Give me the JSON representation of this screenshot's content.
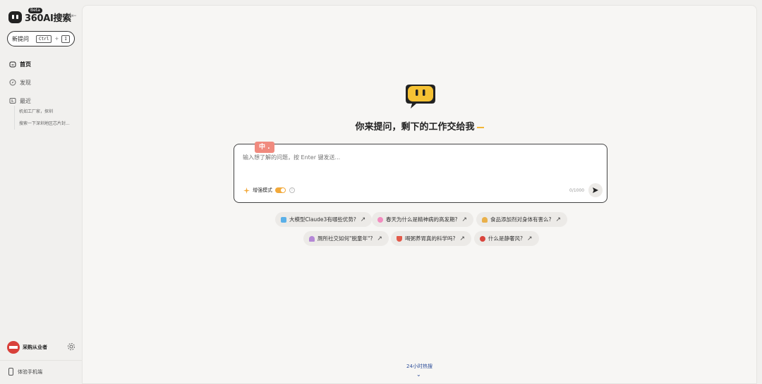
{
  "app": {
    "logo_text": "360AI搜索",
    "logo_badge": "Beta"
  },
  "sidebar": {
    "new_question": {
      "label": "新提问",
      "shortcut_key1": "Ctrl",
      "shortcut_plus": "+",
      "shortcut_key2": "I"
    },
    "nav": [
      {
        "label": "首页",
        "icon": "home-icon"
      },
      {
        "label": "发现",
        "icon": "compass-icon"
      },
      {
        "label": "最近",
        "icon": "history-icon"
      }
    ],
    "recent": [
      "机如工厂家，探圳",
      "搜索一下深圳地区芯片封..."
    ],
    "user": {
      "name": "采购从业者"
    },
    "mobile": {
      "label": "体验手机端"
    }
  },
  "main": {
    "headline": "你来提问，剩下的工作交给我",
    "input": {
      "ime_label": "中 .",
      "placeholder": "输入想了解的问题，按 Enter 键发送...",
      "mode_label": "增强模式",
      "counter": "0/1000"
    },
    "suggestions": [
      {
        "text": "大模型Claude3有哪些优势?",
        "color": "#5ab0e8"
      },
      {
        "text": "春天为什么是精神病的高发期?",
        "color": "#f28cbf"
      },
      {
        "text": "食品添加剂对身体有害么?",
        "color": "#e9b04a"
      },
      {
        "text": "厕所社交如何\"脱童年\"?",
        "color": "#b487d6"
      },
      {
        "text": "喝粥养胃真的科学吗?",
        "color": "#e25a4a"
      },
      {
        "text": "什么是静奢风?",
        "color": "#d9453d"
      }
    ],
    "hot_link": "24小时热搜"
  },
  "colors": {
    "accent": "#f2a93b",
    "ime_badge": "#f08a7e",
    "link": "#2d4e9a"
  }
}
